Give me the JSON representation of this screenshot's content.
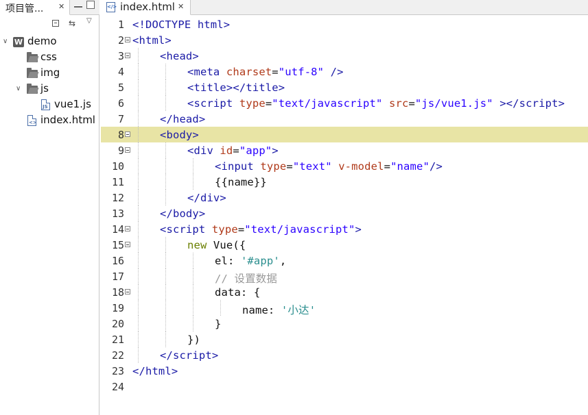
{
  "left_panel": {
    "tab_label": "项目管...",
    "close_glyph": "✕",
    "tree": [
      {
        "label": "demo",
        "type": "project",
        "arrow": "∨"
      },
      {
        "label": "css",
        "type": "folder",
        "arrow": ""
      },
      {
        "label": "img",
        "type": "folder",
        "arrow": ""
      },
      {
        "label": "js",
        "type": "folder",
        "arrow": "∨"
      },
      {
        "label": "vue1.js",
        "type": "js-file",
        "arrow": ""
      },
      {
        "label": "index.html",
        "type": "html-file",
        "arrow": ""
      }
    ]
  },
  "editor": {
    "tab_label": "index.html",
    "close_glyph": "✕",
    "highlighted_line": 8,
    "lines": [
      {
        "n": "1"
      },
      {
        "n": "2"
      },
      {
        "n": "3"
      },
      {
        "n": "4"
      },
      {
        "n": "5"
      },
      {
        "n": "6"
      },
      {
        "n": "7"
      },
      {
        "n": "8"
      },
      {
        "n": "9"
      },
      {
        "n": "10"
      },
      {
        "n": "11"
      },
      {
        "n": "12"
      },
      {
        "n": "13"
      },
      {
        "n": "14"
      },
      {
        "n": "15"
      },
      {
        "n": "16"
      },
      {
        "n": "17"
      },
      {
        "n": "18"
      },
      {
        "n": "19"
      },
      {
        "n": "20"
      },
      {
        "n": "21"
      },
      {
        "n": "22"
      },
      {
        "n": "23"
      },
      {
        "n": "24"
      }
    ],
    "code": {
      "l1": [
        "<!DOCTYPE html>"
      ],
      "l2": [
        "<",
        "html",
        ">"
      ],
      "l3": [
        "<",
        "head",
        ">"
      ],
      "l4": [
        "<",
        "meta",
        " ",
        "charset",
        "=",
        "\"utf-8\"",
        " />"
      ],
      "l5": [
        "<",
        "title",
        "></",
        "title",
        ">"
      ],
      "l6": [
        "<",
        "script",
        " ",
        "type",
        "=",
        "\"text/javascript\"",
        " ",
        "src",
        "=",
        "\"js/vue1.js\"",
        " ></",
        "script",
        ">"
      ],
      "l7": [
        "</",
        "head",
        ">"
      ],
      "l8": [
        "<",
        "body",
        ">"
      ],
      "l9": [
        "<",
        "div",
        " ",
        "id",
        "=",
        "\"app\"",
        ">"
      ],
      "l10": [
        "<",
        "input",
        " ",
        "type",
        "=",
        "\"text\"",
        " ",
        "v-model",
        "=",
        "\"name\"",
        "/>"
      ],
      "l11": [
        "{{name}}"
      ],
      "l12": [
        "</",
        "div",
        ">"
      ],
      "l13": [
        "</",
        "body",
        ">"
      ],
      "l14": [
        "<",
        "script",
        " ",
        "type",
        "=",
        "\"text/javascript\"",
        ">"
      ],
      "l15": [
        "new",
        " Vue({"
      ],
      "l16": [
        "el: ",
        "'#app'",
        ","
      ],
      "l17": [
        "// 设置数据"
      ],
      "l18": [
        "data: {"
      ],
      "l19": [
        "name: ",
        "'小达'"
      ],
      "l20": [
        "}"
      ],
      "l21": [
        "})"
      ],
      "l22": [
        "</",
        "script",
        ">"
      ],
      "l23": [
        "</",
        "html",
        ">"
      ]
    }
  }
}
